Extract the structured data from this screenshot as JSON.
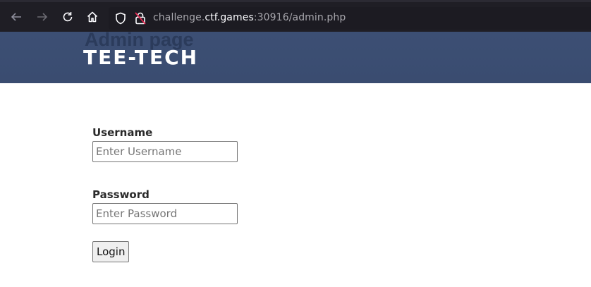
{
  "browser": {
    "url_prefix": "challenge.",
    "url_host": "ctf.games",
    "url_suffix": ":30916/admin.php"
  },
  "header": {
    "page_title": "Admin page",
    "brand": "TEE-TECH"
  },
  "form": {
    "username_label": "Username",
    "username_placeholder": "Enter Username",
    "username_value": "",
    "password_label": "Password",
    "password_placeholder": "Enter Password",
    "password_value": "",
    "login_label": "Login"
  },
  "icons": [
    "back-icon",
    "forward-icon",
    "reload-icon",
    "home-icon",
    "tracking-shield-icon",
    "insecure-lock-icon"
  ],
  "colors": {
    "header_bg": "#3c4f74",
    "toolbar_bg": "#1f1e25"
  }
}
